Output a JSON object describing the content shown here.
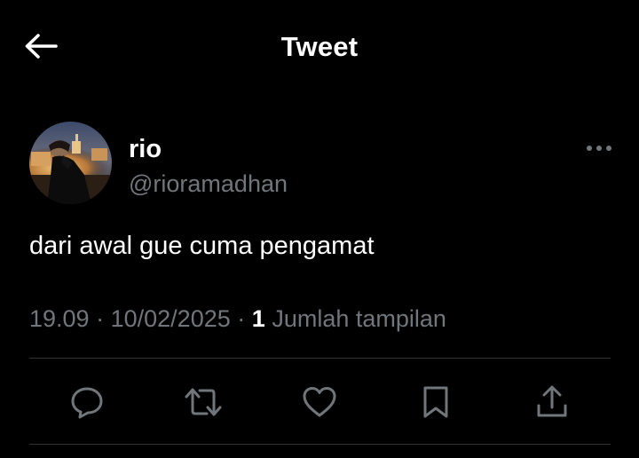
{
  "header": {
    "title": "Tweet",
    "back_icon": "arrow-left-icon"
  },
  "tweet": {
    "author": {
      "display_name": "rio",
      "handle": "@rioramadhan",
      "avatar_icon": "avatar-photo"
    },
    "text": "dari awal gue cuma pengamat",
    "time": "19.09",
    "separator": "·",
    "date": "10/02/2025",
    "views_count": "1",
    "views_label": "Jumlah tampilan",
    "more_icon": "more-horizontal-icon"
  },
  "actions": [
    {
      "name": "reply",
      "icon": "reply-icon"
    },
    {
      "name": "retweet",
      "icon": "retweet-icon"
    },
    {
      "name": "like",
      "icon": "heart-icon"
    },
    {
      "name": "bookmark",
      "icon": "bookmark-icon"
    },
    {
      "name": "share",
      "icon": "share-icon"
    }
  ],
  "colors": {
    "background": "#000000",
    "primary_text": "#ffffff",
    "secondary_text": "#71767b",
    "divider": "#2f3336"
  }
}
